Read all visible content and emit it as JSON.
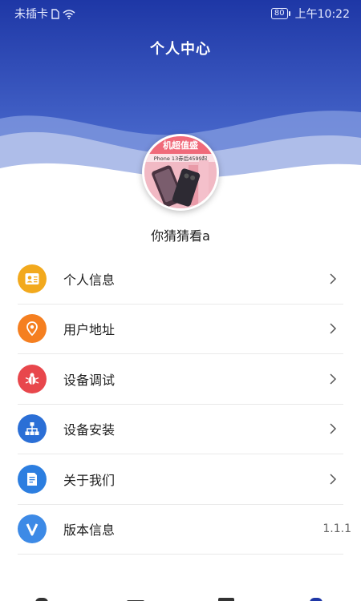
{
  "status_bar": {
    "carrier": "未插卡",
    "battery": "80",
    "time": "上午10:22"
  },
  "header": {
    "title": "个人中心",
    "gradient_top": "#1e37a6",
    "gradient_bottom": "#4f74d8"
  },
  "profile": {
    "username": "你猜猜看a",
    "avatar_banner_text": "机超值盛",
    "avatar_sub_text": "Phone 13券后4599起"
  },
  "menu": {
    "items": [
      {
        "label": "个人信息",
        "icon": "user-card-icon",
        "color": "#f2a91d"
      },
      {
        "label": "用户地址",
        "icon": "location-pin-icon",
        "color": "#f57f20"
      },
      {
        "label": "设备调试",
        "icon": "bug-icon",
        "color": "#e8474c"
      },
      {
        "label": "设备安装",
        "icon": "network-tree-icon",
        "color": "#2b6fd6"
      },
      {
        "label": "关于我们",
        "icon": "document-icon",
        "color": "#2c7ee0"
      },
      {
        "label": "版本信息",
        "icon": "version-v-icon",
        "color": "#3d8ae6",
        "value": "1.1.1"
      }
    ]
  },
  "tabbar": {
    "icons": [
      "home-icon",
      "list-icon",
      "grid-icon",
      "profile-icon"
    ],
    "active_color": "#1e37a6"
  }
}
